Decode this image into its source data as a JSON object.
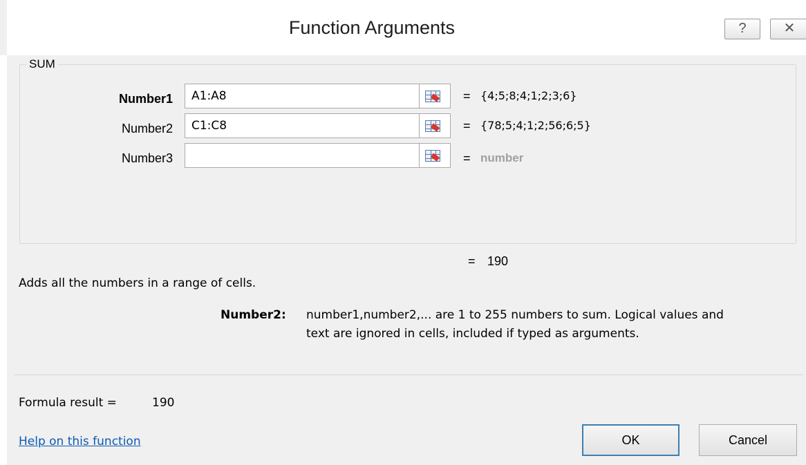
{
  "window": {
    "title": "Function Arguments",
    "help_glyph": "?",
    "close_glyph": "✕"
  },
  "function_group": {
    "name": "SUM",
    "arguments": [
      {
        "label": "Number1",
        "value": "A1:A8",
        "equals": "=",
        "result": "{4;5;8;4;1;2;3;6}"
      },
      {
        "label": "Number2",
        "value": "C1:C8",
        "equals": "=",
        "result": "{78;5;4;1;2;56;6;5}"
      },
      {
        "label": "Number3",
        "value": "",
        "equals": "=",
        "result": "number"
      }
    ]
  },
  "result": {
    "equals": "=",
    "value": "190"
  },
  "description": "Adds all the numbers in a range of cells.",
  "argument_help": {
    "label": "Number2:",
    "line1": "number1,number2,... are 1 to 255 numbers to sum. Logical values and",
    "line2": "text are ignored in cells, included if typed as arguments."
  },
  "formula_result": {
    "label": "Formula result =",
    "value": "190"
  },
  "help_link": "Help on this function",
  "buttons": {
    "ok": "OK",
    "cancel": "Cancel"
  },
  "colors": {
    "link": "#0b5bb5",
    "ok_focus": "#3c7fb1",
    "hint": "#a0a0a0"
  },
  "icons": {
    "ref_picker": "collapse-dialog-icon",
    "help": "help-icon",
    "close": "close-icon"
  }
}
